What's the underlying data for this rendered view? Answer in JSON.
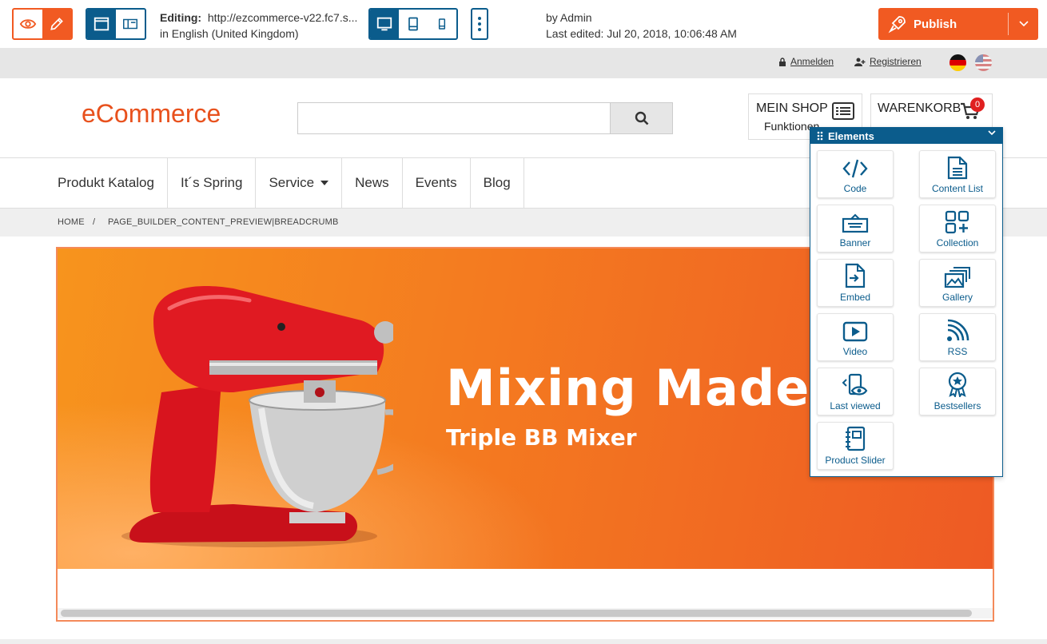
{
  "editor": {
    "editing_label": "Editing:",
    "url": "http://ezcommerce-v22.fc7.s...",
    "language": "in English (United Kingdom)",
    "author": "by Admin",
    "last_edited": "Last edited: Jul 20, 2018, 10:06:48 AM",
    "publish_label": "Publish"
  },
  "utility": {
    "login": "Anmelden",
    "register": "Registrieren"
  },
  "header": {
    "logo": "eCommerce",
    "search_value": "",
    "myshop_title": "MEIN SHOP",
    "myshop_sub": "Funktionen",
    "cart_title": "WARENKORB",
    "cart_count": "0"
  },
  "nav": {
    "items": [
      "Produkt Katalog",
      "It´s Spring",
      "Service",
      "News",
      "Events",
      "Blog"
    ]
  },
  "breadcrumb": {
    "home": "HOME",
    "sep": "/",
    "current": "PAGE_BUILDER_CONTENT_PREVIEW|BREADCRUMB"
  },
  "banner": {
    "headline": "Mixing Made",
    "subline": "Triple BB Mixer"
  },
  "panel": {
    "title": "Elements",
    "items": [
      "Code",
      "Content List",
      "Banner",
      "Collection",
      "Embed",
      "Gallery",
      "Video",
      "RSS",
      "Last viewed",
      "Bestsellers",
      "Product Slider"
    ]
  },
  "colors": {
    "accent": "#f15a22",
    "primary": "#0b5c8c"
  }
}
